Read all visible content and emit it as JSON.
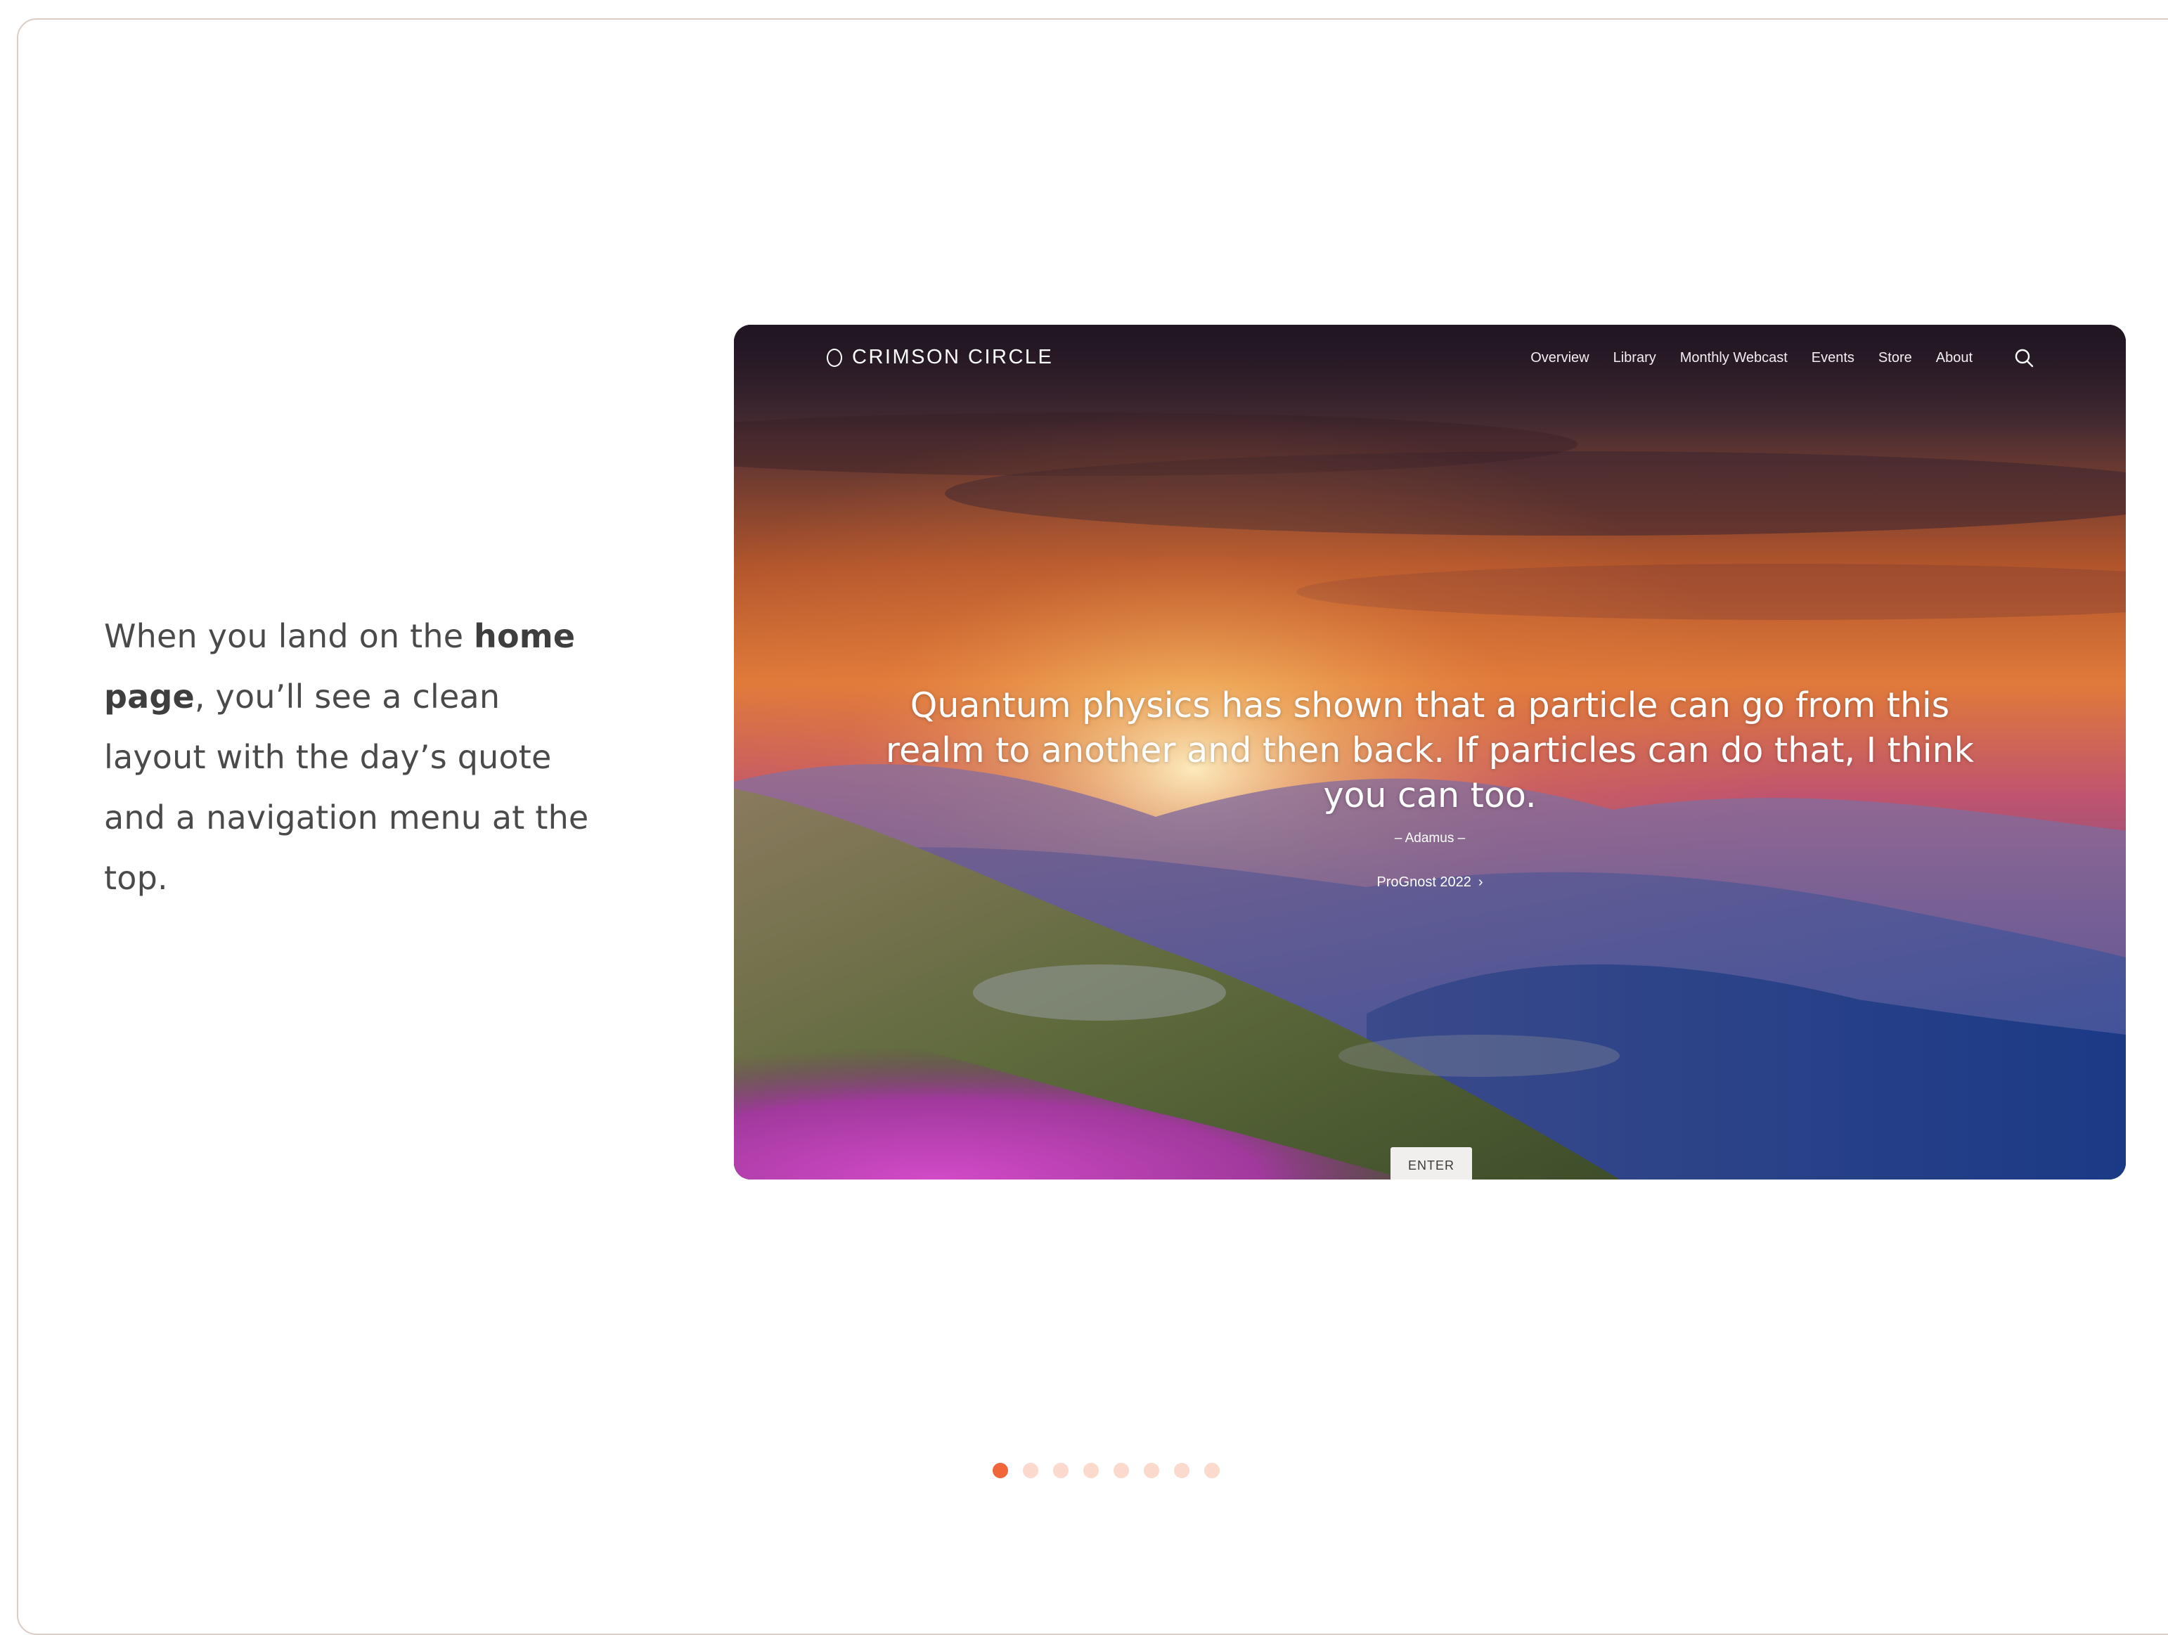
{
  "caption": {
    "before": "When you land on the ",
    "bold": "home page",
    "after": ", you’ll see a clean layout with the day’s quote and a navigation menu at the top."
  },
  "site": {
    "logo_text": "CRIMSON CIRCLE",
    "nav": [
      "Overview",
      "Library",
      "Monthly Webcast",
      "Events",
      "Store",
      "About"
    ],
    "search_icon": "search-icon",
    "quote": "Quantum physics has shown that a particle can go from this realm to another and then back. If particles can do that, I think you can too.",
    "author": "– Adamus –",
    "link_label": "ProGnost 2022",
    "enter_label": "ENTER"
  },
  "carousel": {
    "total": 8,
    "active_index": 0,
    "active_color": "#f0663a",
    "inactive_color": "#fbd9cc"
  }
}
